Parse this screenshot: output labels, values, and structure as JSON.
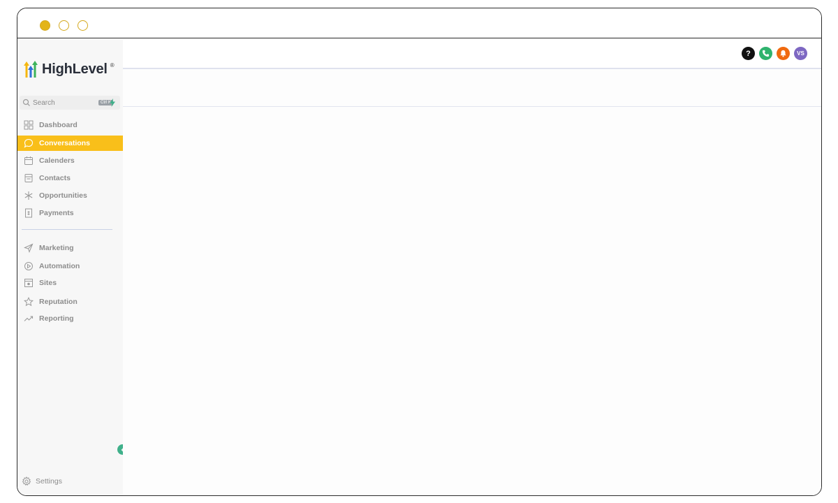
{
  "brand": {
    "name": "HighLevel",
    "reg": "®"
  },
  "search": {
    "label": "Search",
    "shortcut": "Ctrl K"
  },
  "nav": {
    "primary": [
      {
        "key": "dashboard",
        "label": "Dashboard",
        "icon": "grid-icon",
        "active": false
      },
      {
        "key": "conversations",
        "label": "Conversations",
        "icon": "chat-bubble-icon",
        "active": true
      },
      {
        "key": "calenders",
        "label": "Calenders",
        "icon": "calendar-icon",
        "active": false
      },
      {
        "key": "contacts",
        "label": "Contacts",
        "icon": "contact-card-icon",
        "active": false
      },
      {
        "key": "opportunities",
        "label": "Opportunities",
        "icon": "asterisk-icon",
        "active": false
      },
      {
        "key": "payments",
        "label": "Payments",
        "icon": "receipt-icon",
        "active": false
      }
    ],
    "secondary": [
      {
        "key": "marketing",
        "label": "Marketing",
        "icon": "send-icon",
        "active": false
      },
      {
        "key": "automation",
        "label": "Automation",
        "icon": "play-circle-icon",
        "active": false
      },
      {
        "key": "sites",
        "label": "Sites",
        "icon": "window-icon",
        "active": false
      },
      {
        "key": "reputation",
        "label": "Reputation",
        "icon": "star-icon",
        "active": false
      },
      {
        "key": "reporting",
        "label": "Reporting",
        "icon": "trend-icon",
        "active": false
      }
    ]
  },
  "settings": {
    "label": "Settings",
    "icon": "gear-icon"
  },
  "topbar": {
    "help": {
      "label": "?",
      "icon": "help-icon"
    },
    "phone": {
      "icon": "phone-icon"
    },
    "bell": {
      "icon": "bell-icon"
    },
    "avatar": {
      "initials": "VS"
    }
  },
  "colors": {
    "accent": "#f9bf1a",
    "phone": "#2fb36e",
    "bell": "#f06a0f",
    "avatar": "#7d67c2",
    "collapse": "#3fb08a"
  }
}
